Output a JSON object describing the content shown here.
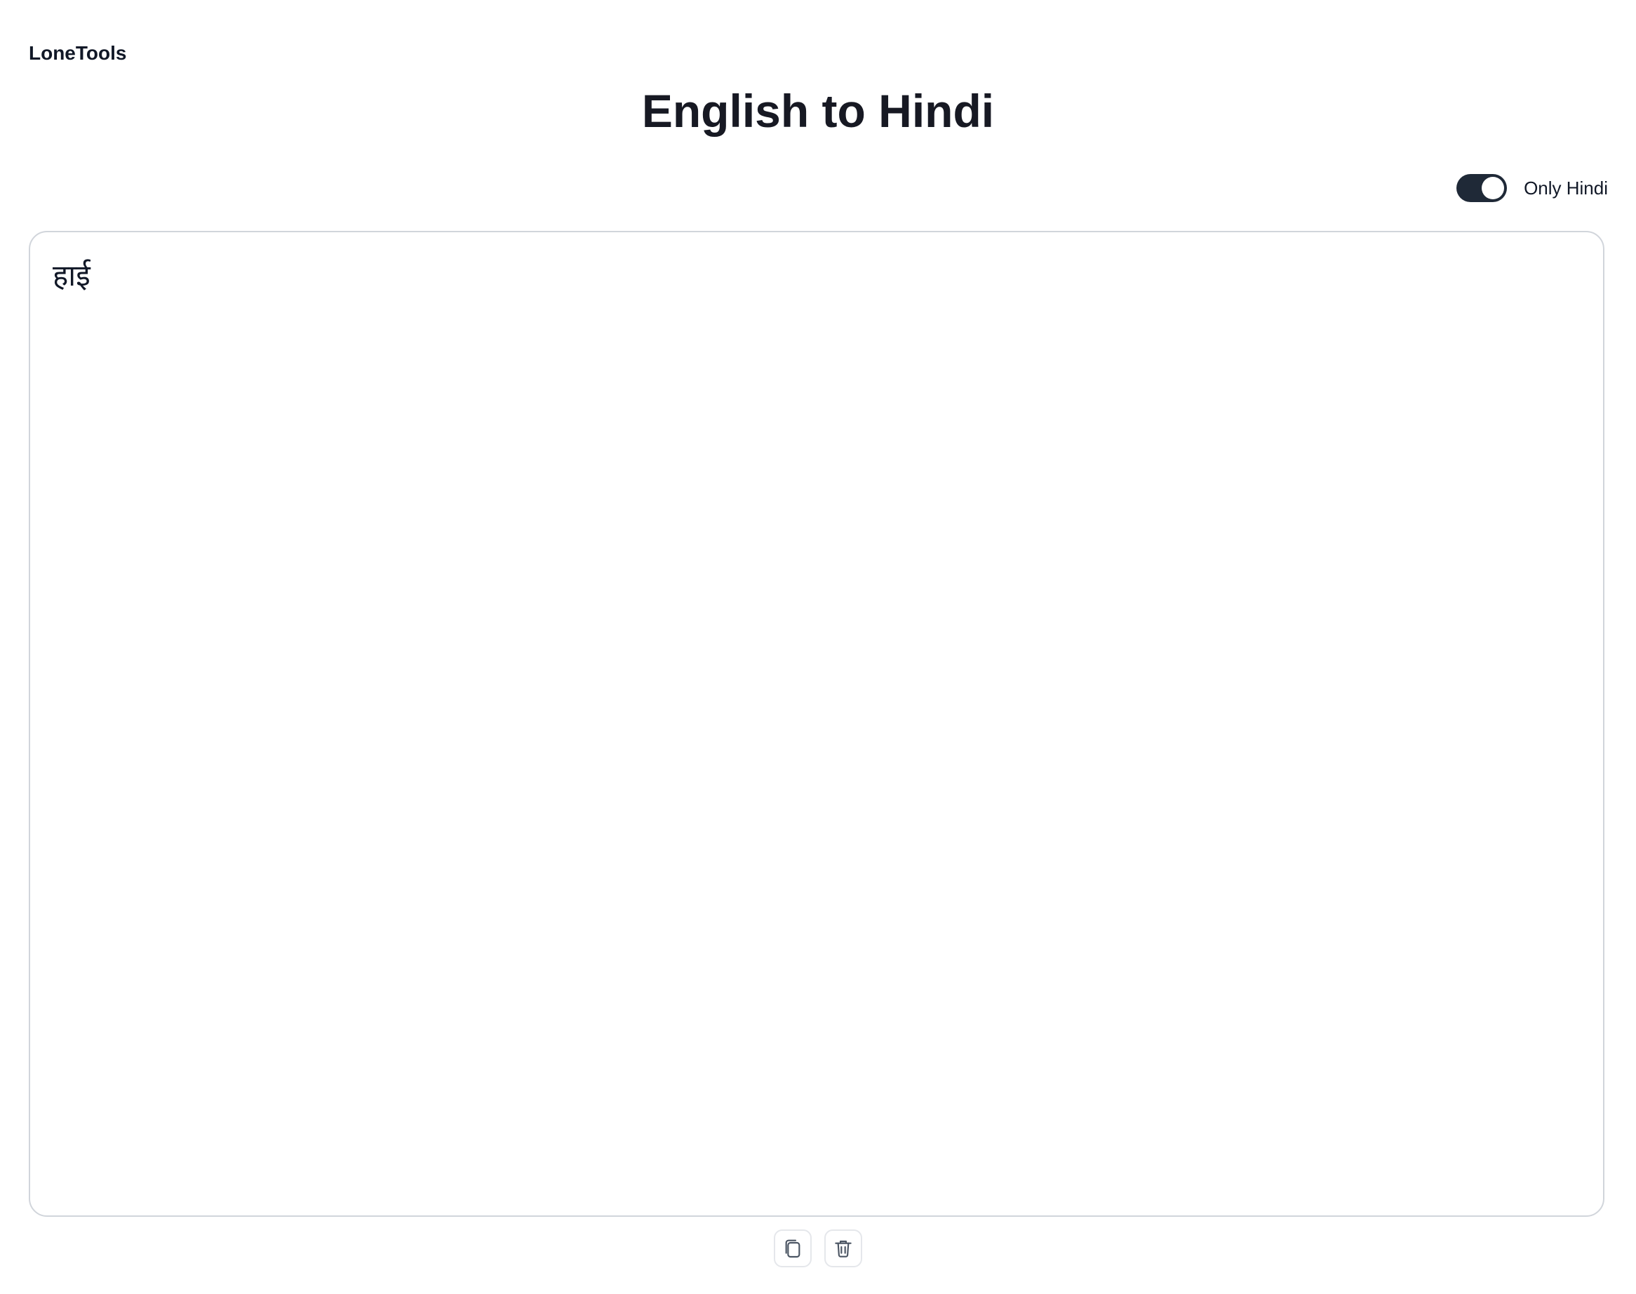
{
  "header": {
    "brand": "LoneTools",
    "title": "English to Hindi"
  },
  "toggle": {
    "label": "Only Hindi",
    "enabled": true,
    "accent_color": "#1f2937"
  },
  "editor": {
    "value": "हाई"
  },
  "actions": {
    "copy_icon": "copy-icon",
    "delete_icon": "trash-icon"
  }
}
